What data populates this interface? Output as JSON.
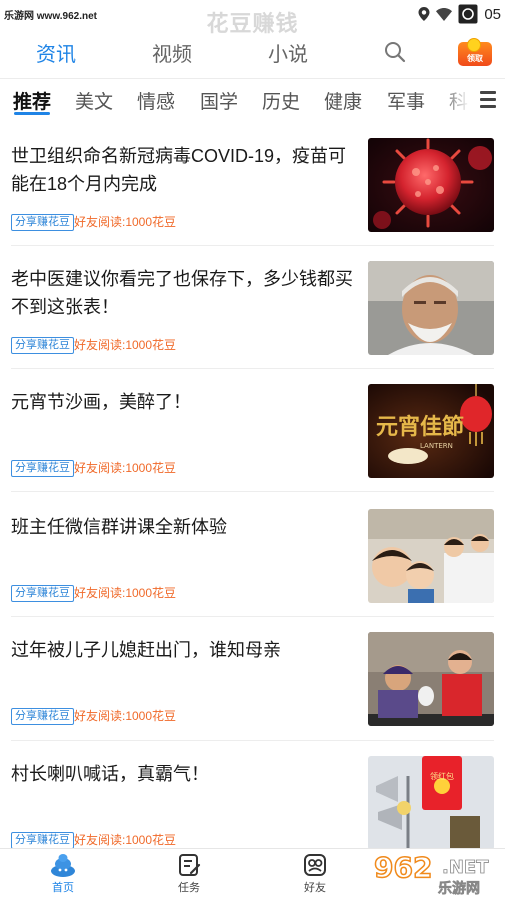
{
  "status_bar": {
    "watermark_left": "乐游网 www.962.net",
    "app_title": "花豆赚钱",
    "time": "05"
  },
  "top_nav": {
    "tabs": [
      {
        "label": "资讯",
        "active": true
      },
      {
        "label": "视频",
        "active": false
      },
      {
        "label": "小说",
        "active": false
      }
    ],
    "search_icon": "search-icon",
    "redpack_label": "领取"
  },
  "categories": [
    {
      "label": "推荐",
      "active": true
    },
    {
      "label": "美文",
      "active": false
    },
    {
      "label": "情感",
      "active": false
    },
    {
      "label": "国学",
      "active": false
    },
    {
      "label": "历史",
      "active": false
    },
    {
      "label": "健康",
      "active": false
    },
    {
      "label": "军事",
      "active": false
    },
    {
      "label": "科",
      "active": false
    }
  ],
  "news": [
    {
      "title": "世卫组织命名新冠病毒COVID-19，疫苗可能在18个月内完成",
      "tag": "分享赚花豆",
      "reward": "好友阅读:1000花豆",
      "thumb": "virus"
    },
    {
      "title": "老中医建议你看完了也保存下，多少钱都买不到这张表！",
      "tag": "分享赚花豆",
      "reward": "好友阅读:1000花豆",
      "thumb": "elder"
    },
    {
      "title": "元宵节沙画，美醉了！",
      "tag": "分享赚花豆",
      "reward": "好友阅读:1000花豆",
      "thumb": "lantern"
    },
    {
      "title": "班主任微信群讲课全新体验",
      "tag": "分享赚花豆",
      "reward": "好友阅读:1000花豆",
      "thumb": "kids"
    },
    {
      "title": "过年被儿子儿媳赶出门，谁知母亲",
      "tag": "分享赚花豆",
      "reward": "好友阅读:1000花豆",
      "thumb": "mother"
    },
    {
      "title": "村长喇叭喊话，真霸气！",
      "tag": "分享赚花豆",
      "reward": "好友阅读:1000花豆",
      "thumb": "speaker"
    }
  ],
  "thumb_text": {
    "lantern_main": "元宵佳節",
    "lantern_sub": "LANTERN",
    "speaker_sign": "领红包"
  },
  "bottom_nav": [
    {
      "label": "首页",
      "icon": "home-icon",
      "active": true
    },
    {
      "label": "任务",
      "icon": "task-icon",
      "active": false
    },
    {
      "label": "好友",
      "icon": "friends-icon",
      "active": false
    }
  ],
  "watermark_corner": {
    "number": "962",
    "suffix": ".NET",
    "text": "乐游网"
  },
  "colors": {
    "accent": "#1f84e6",
    "reward": "#f06a2a",
    "tag_border": "#3d8fe0"
  }
}
